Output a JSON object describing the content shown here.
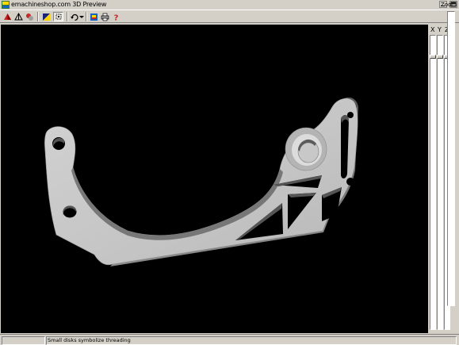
{
  "window": {
    "title": "emachineshop.com 3D Preview",
    "controls": [
      "minimize",
      "maximize"
    ]
  },
  "toolbar": {
    "buttons": [
      {
        "name": "shade-icon",
        "tooltip": ""
      },
      {
        "name": "wireframe-icon",
        "tooltip": ""
      },
      {
        "name": "explode-icon",
        "tooltip": ""
      },
      {
        "name": "background-color-icon",
        "tooltip": ""
      },
      {
        "name": "fit-view-icon",
        "tooltip": ""
      },
      {
        "name": "rotate-icon",
        "tooltip": ""
      },
      {
        "name": "dropdown-arrow-icon",
        "tooltip": ""
      },
      {
        "name": "copy-image-icon",
        "tooltip": ""
      },
      {
        "name": "print-icon",
        "tooltip": ""
      },
      {
        "name": "help-icon",
        "tooltip": ""
      }
    ]
  },
  "side_panel": {
    "axis_x": "X",
    "axis_y": "Y",
    "axis_z": "Z",
    "zoom_label": "Zoom"
  },
  "status": {
    "message": "Small disks symbolize threading"
  },
  "colors": {
    "chrome": "#d4d0c8",
    "viewport": "#000000",
    "part": "#c8c8c8"
  }
}
